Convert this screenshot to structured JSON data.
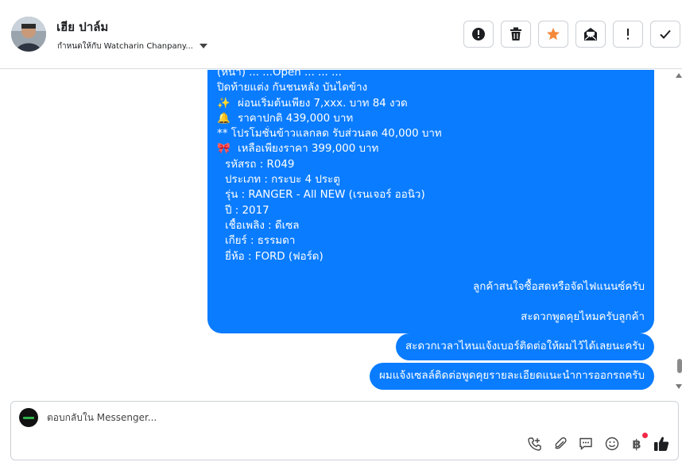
{
  "header": {
    "contact_name": "เฮีย ปาล์ม",
    "assigned_label": "กำหนดให้กับ Watcharin Chanpany...",
    "actions": [
      {
        "name": "mark-spam-button",
        "icon": "exclamation-circle-icon"
      },
      {
        "name": "delete-button",
        "icon": "trash-icon"
      },
      {
        "name": "star-button",
        "icon": "star-icon",
        "color": "#f5883a"
      },
      {
        "name": "mark-unread-button",
        "icon": "envelope-open-icon"
      },
      {
        "name": "follow-up-button",
        "icon": "exclamation-icon"
      },
      {
        "name": "mark-done-button",
        "icon": "check-icon"
      }
    ]
  },
  "conversation": {
    "long_message": {
      "lines": [
        {
          "emoji": "",
          "text": "(หน้า) ...  ...Open ...  ... ...",
          "indent": false
        },
        {
          "emoji": "",
          "text": "ปิดท้ายแต่ง กันชนหลัง บันไดข้าง",
          "indent": false
        },
        {
          "emoji": "✨",
          "text": "ผ่อนเริ่มต้นเพียง 7,xxx. บาท 84 งวด",
          "indent": false
        },
        {
          "emoji": "🔔",
          "text": "ราคาปกติ 439,000 บาท",
          "indent": false
        },
        {
          "emoji": "",
          "text": "** โปรโมชั่นข้าวแลกลด รับส่วนลด 40,000 บาท",
          "indent": false
        },
        {
          "emoji": "🎀",
          "text": "เหลือเพียงราคา 399,000 บาท",
          "indent": false
        },
        {
          "emoji": "",
          "text": "รหัสรถ : R049",
          "indent": true
        },
        {
          "emoji": "",
          "text": "ประเภท : กระบะ 4 ประตู",
          "indent": true
        },
        {
          "emoji": "",
          "text": "รุ่น : RANGER - All NEW (เรนเจอร์ ออนิว)",
          "indent": true
        },
        {
          "emoji": "",
          "text": "ปี : 2017",
          "indent": true
        },
        {
          "emoji": "",
          "text": "เชื้อเพลิง : ดีเซล",
          "indent": true
        },
        {
          "emoji": "",
          "text": "เกียร์ : ธรรมดา",
          "indent": true
        },
        {
          "emoji": "",
          "text": "ยี่ห้อ : FORD (ฟอร์ด)",
          "indent": true
        }
      ]
    },
    "messages": [
      "ลูกค้าสนใจซื้อสดหรือจัดไฟแนนซ์ครับ",
      "สะดวกพูดคุยไหมครับลูกค้า",
      "สะดวกเวลาไหนแจ้งเบอร์ติดต่อให้ผมไว้ได้เลยนะครับ",
      "ผมแจ้งเซลล์ติดต่อพูดคุยรายละเอียดแนะนำการออกรถครับ"
    ],
    "bubble_color": "#0a7cff"
  },
  "composer": {
    "placeholder": "ตอบกลับใน Messenger...",
    "tools": [
      {
        "name": "phone-add-icon"
      },
      {
        "name": "attachment-icon"
      },
      {
        "name": "saved-reply-icon"
      },
      {
        "name": "emoji-icon"
      },
      {
        "name": "payment-icon",
        "symbol": "฿"
      },
      {
        "name": "like-icon"
      }
    ]
  }
}
